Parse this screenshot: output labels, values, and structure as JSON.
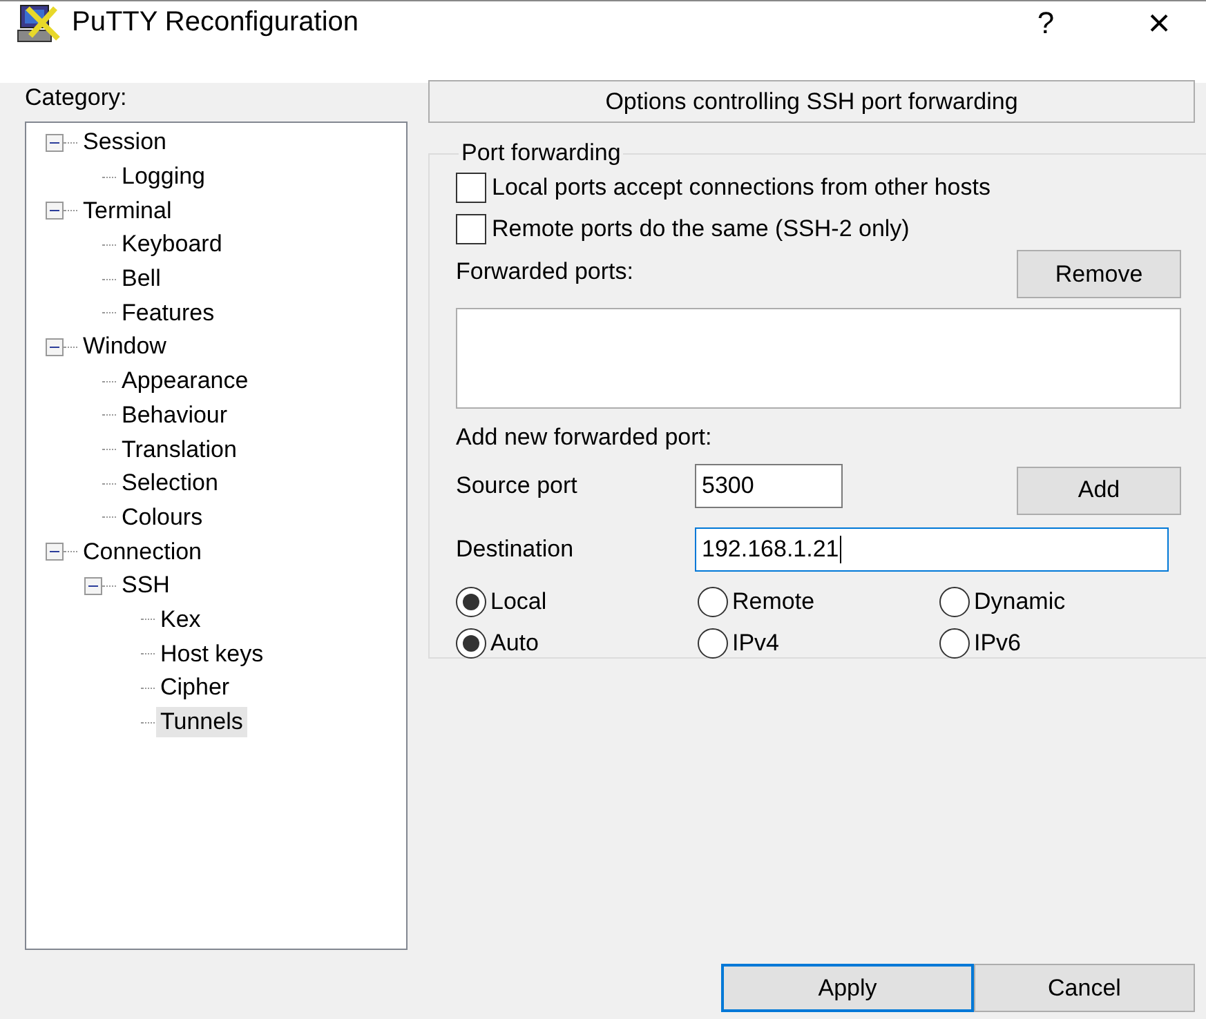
{
  "window": {
    "title": "PuTTY Reconfiguration",
    "help_button": "?",
    "close_button": "×"
  },
  "category": {
    "label": "Category:",
    "tree": [
      {
        "label": "Session",
        "expanded": true,
        "selected": false,
        "children": [
          {
            "label": "Logging",
            "selected": false
          }
        ]
      },
      {
        "label": "Terminal",
        "expanded": true,
        "selected": false,
        "children": [
          {
            "label": "Keyboard",
            "selected": false
          },
          {
            "label": "Bell",
            "selected": false
          },
          {
            "label": "Features",
            "selected": false
          }
        ]
      },
      {
        "label": "Window",
        "expanded": true,
        "selected": false,
        "children": [
          {
            "label": "Appearance",
            "selected": false
          },
          {
            "label": "Behaviour",
            "selected": false
          },
          {
            "label": "Translation",
            "selected": false
          },
          {
            "label": "Selection",
            "selected": false
          },
          {
            "label": "Colours",
            "selected": false
          }
        ]
      },
      {
        "label": "Connection",
        "expanded": true,
        "selected": false,
        "children": [
          {
            "label": "SSH",
            "expanded": true,
            "selected": false,
            "children": [
              {
                "label": "Kex",
                "selected": false
              },
              {
                "label": "Host keys",
                "selected": false
              },
              {
                "label": "Cipher",
                "selected": false
              },
              {
                "label": "Tunnels",
                "selected": true
              }
            ]
          }
        ]
      }
    ]
  },
  "panel": {
    "header": "Options controlling SSH port forwarding",
    "group": "Port forwarding",
    "checkboxes": [
      {
        "label": "Local ports accept connections from other hosts",
        "checked": false
      },
      {
        "label": "Remote ports do the same (SSH-2 only)",
        "checked": false
      }
    ],
    "forwarded_label": "Forwarded ports:",
    "remove_button": "Remove",
    "add_label": "Add new forwarded port:",
    "source": {
      "label": "Source port",
      "value": "5300"
    },
    "destination": {
      "label": "Destination",
      "value": "192.168.1.21",
      "focused": true
    },
    "add_button": "Add",
    "radio_rows": [
      [
        {
          "label": "Local",
          "selected": true
        },
        {
          "label": "Remote",
          "selected": false
        },
        {
          "label": "Dynamic",
          "selected": false
        }
      ],
      [
        {
          "label": "Auto",
          "selected": true
        },
        {
          "label": "IPv4",
          "selected": false
        },
        {
          "label": "IPv6",
          "selected": false
        }
      ]
    ]
  },
  "buttons": [
    {
      "label": "Apply",
      "default": true
    },
    {
      "label": "Cancel",
      "default": false
    }
  ]
}
